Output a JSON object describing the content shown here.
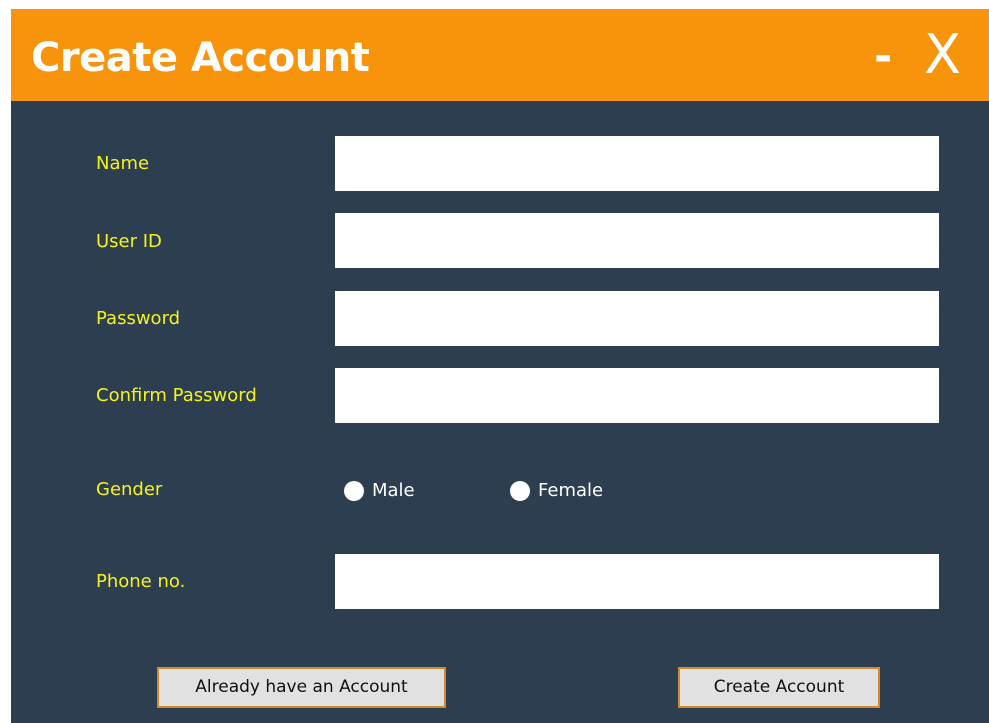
{
  "window": {
    "title": "Create Account",
    "minimize_label": "-",
    "close_label": "X"
  },
  "form": {
    "name_label": "Name",
    "name_value": "",
    "userid_label": "User ID",
    "userid_value": "",
    "password_label": "Password",
    "password_value": "",
    "confirm_label": "Confirm Password",
    "confirm_value": "",
    "gender_label": "Gender",
    "gender_options": [
      "Male",
      "Female"
    ],
    "phone_label": "Phone no.",
    "phone_value": ""
  },
  "buttons": {
    "login_label": "Already have an Account",
    "create_label": "Create Account"
  },
  "colors": {
    "titlebar": "#f7940c",
    "background": "#2d3e50",
    "label_text": "#f4f41c",
    "button_border": "#d18a2c"
  }
}
